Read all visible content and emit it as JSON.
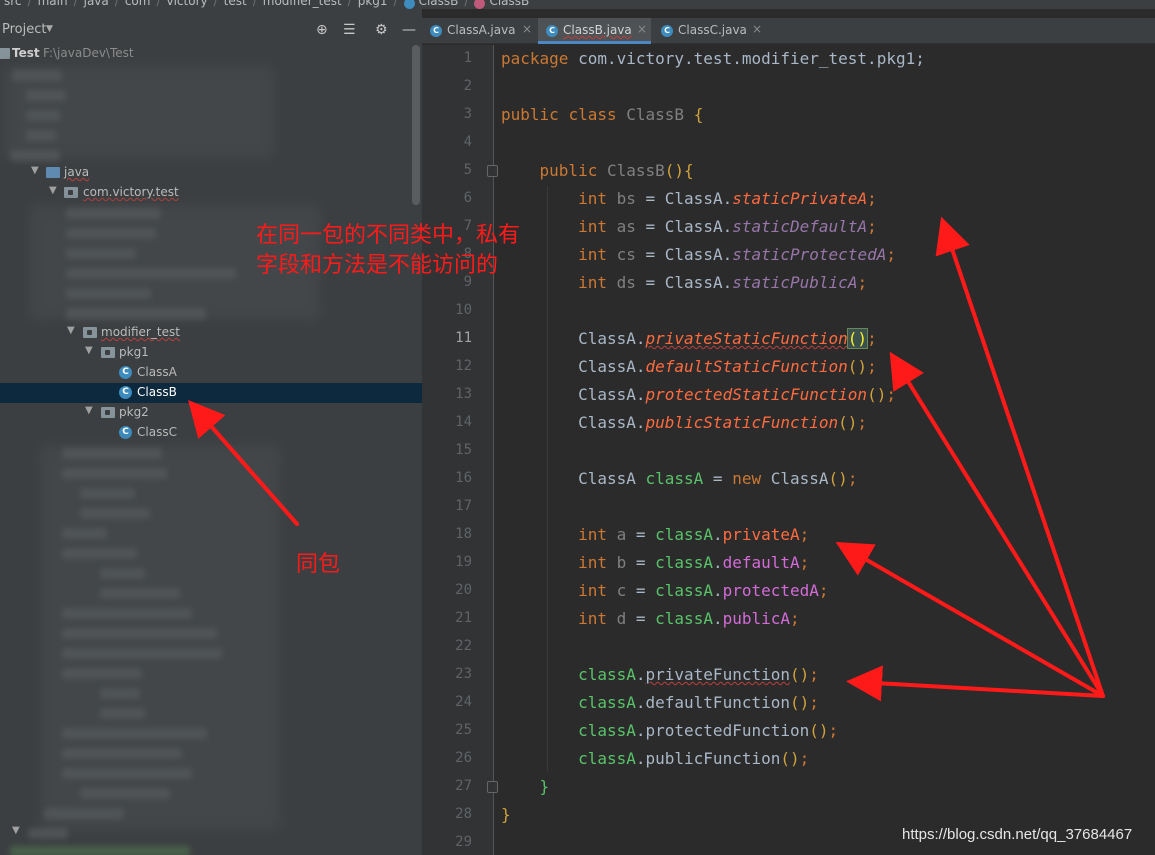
{
  "breadcrumb": {
    "items": [
      "src",
      "main",
      "java",
      "com",
      "victory",
      "test",
      "modifier_test",
      "pkg1",
      "ClassB",
      "ClassB"
    ]
  },
  "project_panel": {
    "title": "Project",
    "icons": [
      "crosshair-icon",
      "collapse-icon",
      "gear-icon",
      "minimize-icon"
    ],
    "root": {
      "name": "Test",
      "path": "F:\\javaDev\\Test"
    },
    "tree": {
      "java": "java",
      "package": "com.victory.test",
      "modifier_test": "modifier_test",
      "pkg1": "pkg1",
      "classA": "ClassA",
      "classB": "ClassB",
      "pkg2": "pkg2",
      "classC": "ClassC"
    }
  },
  "tabs": [
    {
      "label": "ClassA.java",
      "active": false
    },
    {
      "label": "ClassB.java",
      "active": true
    },
    {
      "label": "ClassC.java",
      "active": false
    }
  ],
  "editor": {
    "current_line": 11,
    "line_numbers": [
      "1",
      "2",
      "3",
      "4",
      "5",
      "6",
      "7",
      "8",
      "9",
      "10",
      "11",
      "12",
      "13",
      "14",
      "15",
      "16",
      "17",
      "18",
      "19",
      "20",
      "21",
      "22",
      "23",
      "24",
      "25",
      "26",
      "27",
      "28",
      "29"
    ],
    "code": {
      "l1_kw": "package",
      "l1_rest": " com.victory.test.modifier_test.pkg1;",
      "l3_kw1": "public",
      "l3_kw2": "class",
      "l3_name": "ClassB",
      "l3_brace": "{",
      "l5_kw": "public",
      "l5_name": "ClassB",
      "l5_rest": "(){",
      "l6_type": "int",
      "l6_var": "bs",
      "l6_cls": "ClassA",
      "l6_field": "staticPrivateA",
      "l7_type": "int",
      "l7_var": "as",
      "l7_cls": "ClassA",
      "l7_field": "staticDefaultA",
      "l8_type": "int",
      "l8_var": "cs",
      "l8_cls": "ClassA",
      "l8_field": "staticProtectedA",
      "l9_type": "int",
      "l9_var": "ds",
      "l9_cls": "ClassA",
      "l9_field": "staticPublicA",
      "l11_cls": "ClassA",
      "l11_m": "privateStaticFunction",
      "l12_cls": "ClassA",
      "l12_m": "defaultStaticFunction",
      "l13_cls": "ClassA",
      "l13_m": "protectedStaticFunction",
      "l14_cls": "ClassA",
      "l14_m": "publicStaticFunction",
      "l16_type": "ClassA",
      "l16_var": "classA",
      "l16_new": "new",
      "l16_cls": "ClassA",
      "l18_type": "int",
      "l18_var": "a",
      "l18_obj": "classA",
      "l18_field": "privateA",
      "l19_type": "int",
      "l19_var": "b",
      "l19_obj": "classA",
      "l19_field": "defaultA",
      "l20_type": "int",
      "l20_var": "c",
      "l20_obj": "classA",
      "l20_field": "protectedA",
      "l21_type": "int",
      "l21_var": "d",
      "l21_obj": "classA",
      "l21_field": "publicA",
      "l23_obj": "classA",
      "l23_m": "privateFunction",
      "l24_obj": "classA",
      "l24_m": "defaultFunction",
      "l25_obj": "classA",
      "l25_m": "protectedFunction",
      "l26_obj": "classA",
      "l26_m": "publicFunction",
      "l27_close": "}",
      "l28_close": "}"
    }
  },
  "annotations": {
    "note1_line1": "在同一包的不同类中，私有",
    "note1_line2": "字段和方法是不能访问的",
    "note2": "同包",
    "arrow_color": "#ff1a1a"
  },
  "watermark": "https://blog.csdn.net/qq_37684467",
  "colors": {
    "keyword": "#cc7832",
    "field": "#9876aa",
    "error_member": "#ff6b3f",
    "local_var": "#59c36a",
    "selection": "#0d293e",
    "tab_accent": "#4a88c7"
  }
}
